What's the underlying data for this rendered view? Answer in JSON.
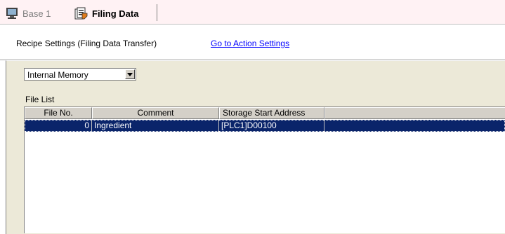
{
  "tabs": [
    {
      "label": "Base 1",
      "icon": "screen-icon",
      "active": false
    },
    {
      "label": "Filing Data",
      "icon": "filing-data-icon",
      "active": true
    }
  ],
  "header": {
    "title": "Recipe Settings (Filing Data Transfer)",
    "link": "Go to Action Settings"
  },
  "storage_select": {
    "value": "Internal Memory"
  },
  "file_list": {
    "label": "File List",
    "columns": [
      "File No.",
      "Comment",
      "Storage Start Address",
      ""
    ],
    "rows": [
      {
        "file_no": "0",
        "comment": "Ingredient",
        "storage_start_address": "[PLC1]D00100",
        "selected": true
      }
    ]
  },
  "colors": {
    "tab_strip_bg": "#fff2f4",
    "panel_bg": "#ece9d8",
    "selection_bg": "#0a246a",
    "link": "#0000ff"
  }
}
